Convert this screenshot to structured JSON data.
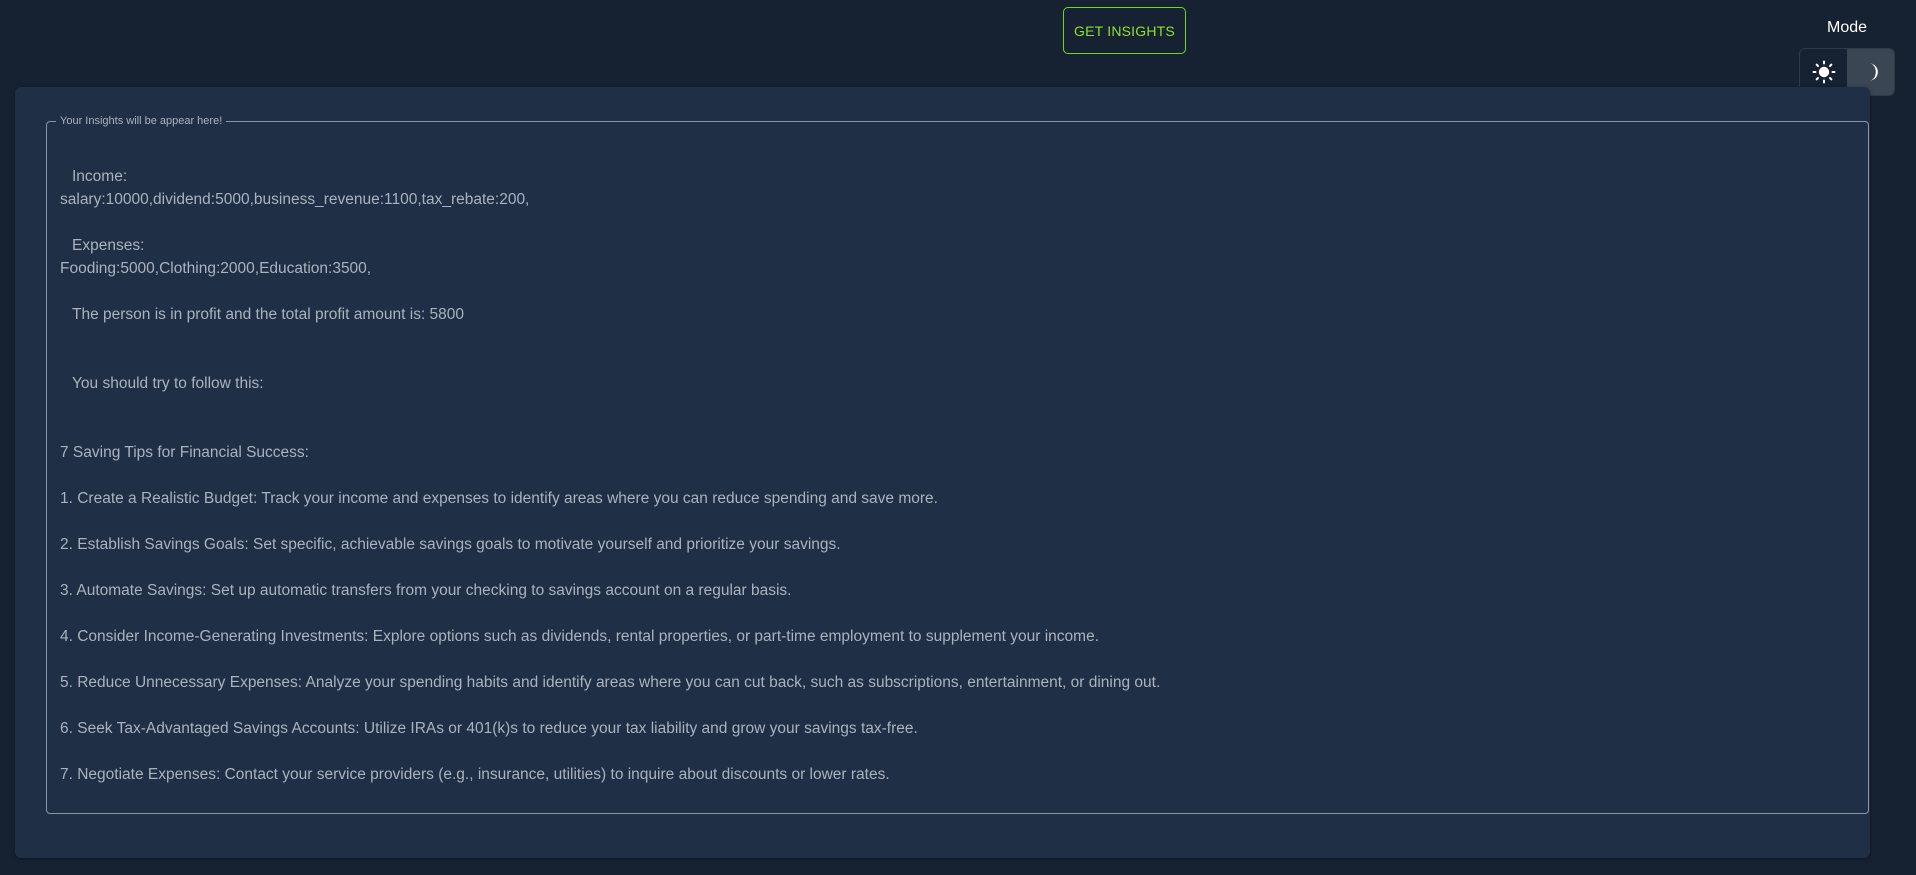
{
  "header": {
    "insights_button_label": "GET INSIGHTS",
    "mode_label": "Mode",
    "mode_options": [
      "light",
      "dark"
    ],
    "active_mode": "dark",
    "accent_color": "#8fe02d"
  },
  "insights": {
    "legend": "Your Insights will be appear here!",
    "income_heading": "Income:",
    "income_values": "salary:10000,dividend:5000,business_revenue:1100,tax_rebate:200,",
    "expenses_heading": "Expenses:",
    "expenses_values": "Fooding:5000,Clothing:2000,Education:3500,",
    "profit_statement": "The person is in profit and the total profit amount is: 5800",
    "advice_intro": "You should try to follow this:",
    "tips_title": "7 Saving Tips for Financial Success:",
    "tips": [
      "1. Create a Realistic Budget: Track your income and expenses to identify areas where you can reduce spending and save more.",
      "2. Establish Savings Goals: Set specific, achievable savings goals to motivate yourself and prioritize your savings.",
      "3. Automate Savings: Set up automatic transfers from your checking to savings account on a regular basis.",
      "4. Consider Income-Generating Investments: Explore options such as dividends, rental properties, or part-time employment to supplement your income.",
      "5. Reduce Unnecessary Expenses: Analyze your spending habits and identify areas where you can cut back, such as subscriptions, entertainment, or dining out.",
      "6. Seek Tax-Advantaged Savings Accounts: Utilize IRAs or 401(k)s to reduce your tax liability and grow your savings tax-free.",
      "7. Negotiate Expenses: Contact your service providers (e.g., insurance, utilities) to inquire about discounts or lower rates."
    ]
  }
}
